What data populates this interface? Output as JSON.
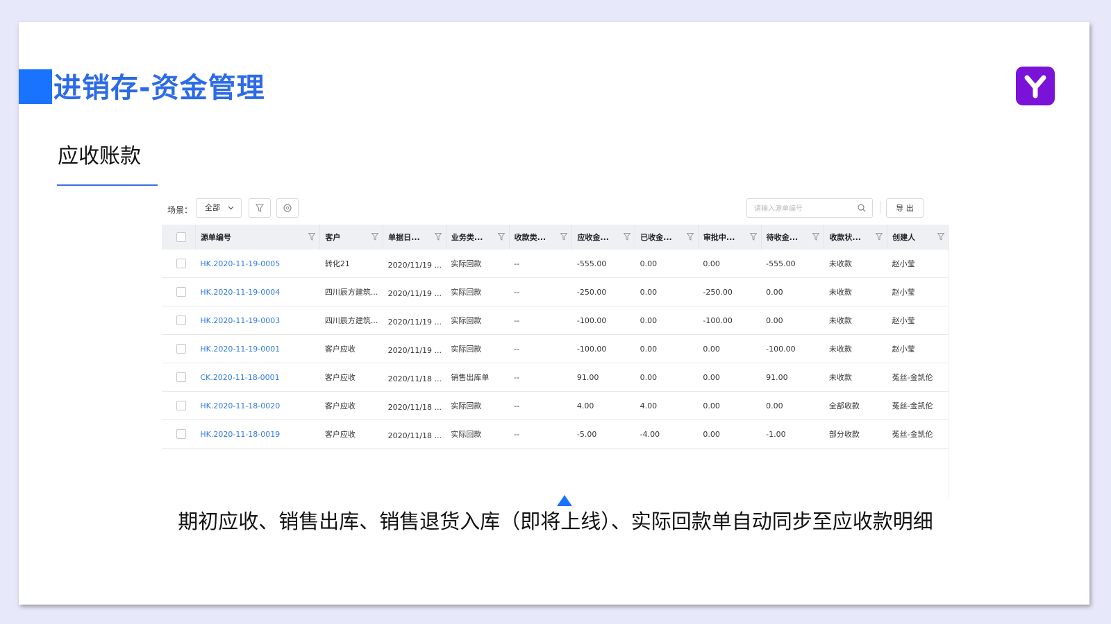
{
  "slide": {
    "title": "进销存-资金管理",
    "subtitle": "应收账款",
    "caption": "期初应收、销售出库、销售退货入库（即将上线）、实际回款单自动同步至应收款明细",
    "accent_color": "#1a73ff",
    "logo_color": "#7a12d8",
    "logo_icon": "y-logo-icon"
  },
  "toolbar": {
    "scene_label": "场景：",
    "scene_value": "全部",
    "filter_icon": "funnel-icon",
    "settings_icon": "gear-icon",
    "search_placeholder": "请输入源单编号",
    "search_icon": "search-icon",
    "export_label": "导 出"
  },
  "table": {
    "headers": [
      "源单编号",
      "客户",
      "单据日...",
      "业务类...",
      "收款类...",
      "应收金...",
      "已收金...",
      "审批中...",
      "待收金...",
      "收款状...",
      "创建人"
    ],
    "link_color": "#2f7ae5",
    "rows": [
      [
        "HK.2020-11-19-0005",
        "转化21",
        "2020/11/19 ...",
        "实际回款",
        "--",
        "-555.00",
        "0.00",
        "0.00",
        "-555.00",
        "未收款",
        "赵小莹"
      ],
      [
        "HK.2020-11-19-0004",
        "四川辰方建筑...",
        "2020/11/19 ...",
        "实际回款",
        "--",
        "-250.00",
        "0.00",
        "-250.00",
        "0.00",
        "未收款",
        "赵小莹"
      ],
      [
        "HK.2020-11-19-0003",
        "四川辰方建筑...",
        "2020/11/19 ...",
        "实际回款",
        "--",
        "-100.00",
        "0.00",
        "-100.00",
        "0.00",
        "未收款",
        "赵小莹"
      ],
      [
        "HK.2020-11-19-0001",
        "客户应收",
        "2020/11/19 ...",
        "实际回款",
        "--",
        "-100.00",
        "0.00",
        "0.00",
        "-100.00",
        "未收款",
        "赵小莹"
      ],
      [
        "CK.2020-11-18-0001",
        "客户应收",
        "2020/11/18 ...",
        "销售出库单",
        "--",
        "91.00",
        "0.00",
        "0.00",
        "91.00",
        "未收款",
        "菟丝-金凯伦"
      ],
      [
        "HK.2020-11-18-0020",
        "客户应收",
        "2020/11/18 ...",
        "实际回款",
        "--",
        "4.00",
        "4.00",
        "0.00",
        "0.00",
        "全部收款",
        "菟丝-金凯伦"
      ],
      [
        "HK.2020-11-18-0019",
        "客户应收",
        "2020/11/18 ...",
        "实际回款",
        "--",
        "-5.00",
        "-4.00",
        "0.00",
        "-1.00",
        "部分收款",
        "菟丝-金凯伦"
      ]
    ]
  }
}
